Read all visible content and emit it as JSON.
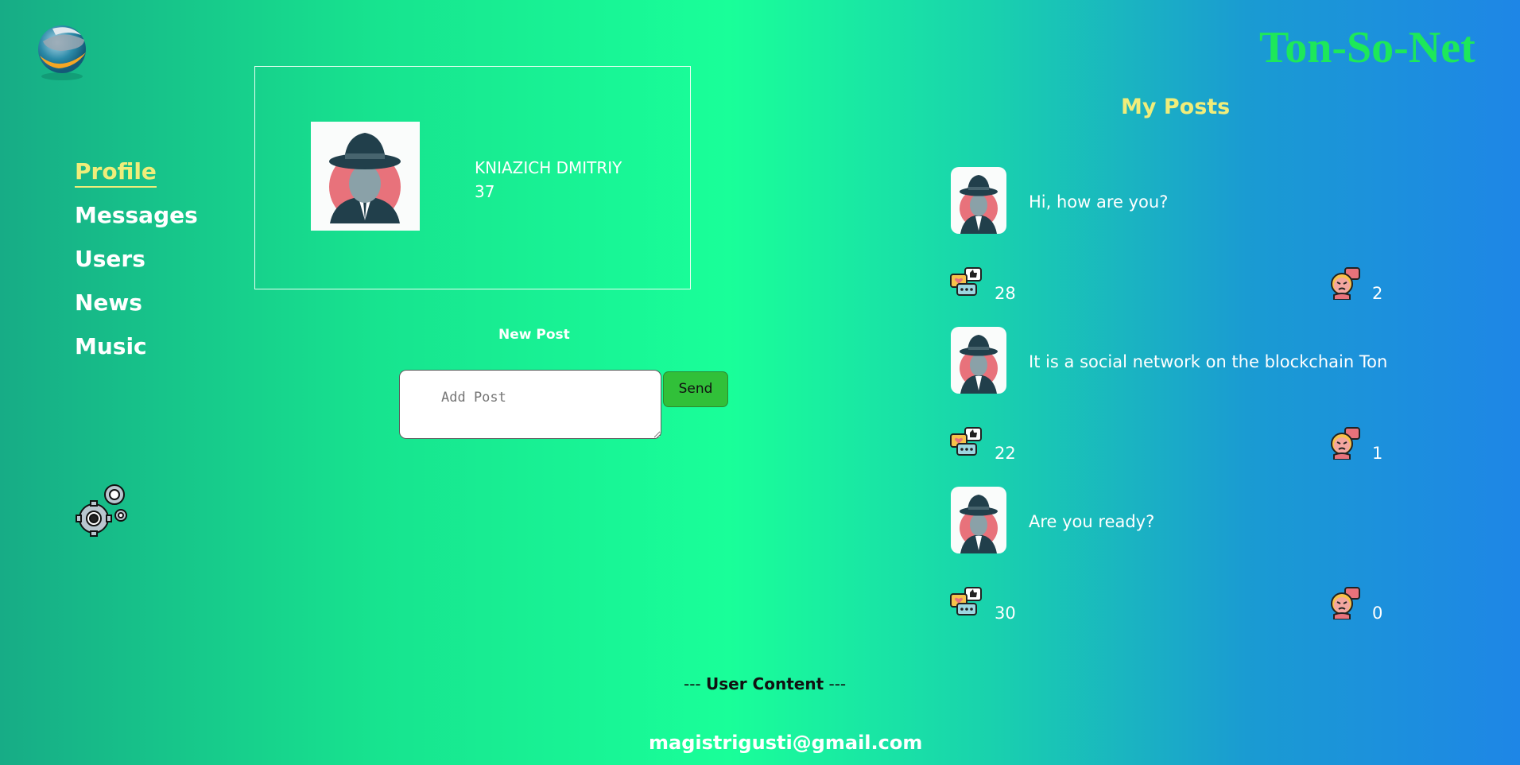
{
  "brand": "Ton-So-Net",
  "nav": {
    "items": [
      "Profile",
      "Messages",
      "Users",
      "News",
      "Music"
    ],
    "active": "Profile"
  },
  "profile": {
    "name": "KNIAZICH DMITRIY",
    "age": "37"
  },
  "new_post": {
    "title": "New Post",
    "placeholder": "Add Post",
    "send_label": "Send"
  },
  "posts": {
    "title": "My Posts",
    "items": [
      {
        "text": "Hi, how are you?",
        "likes": "28",
        "dislikes": "2"
      },
      {
        "text": "It is a social network on the blockchain Ton",
        "likes": "22",
        "dislikes": "1"
      },
      {
        "text": "Are you ready?",
        "likes": "30",
        "dislikes": "0"
      }
    ]
  },
  "footer": {
    "prefix": "--- ",
    "label": "User Content",
    "suffix": " ---",
    "email": "magistrigusti@gmail.com"
  },
  "colors": {
    "active_nav": "#f0ed7a",
    "brand": "#1de85a",
    "send_button": "#31c039"
  },
  "icons": [
    "logo-globe-icon",
    "settings-gears-icon",
    "avatar-detective-icon",
    "reactions-icon",
    "angry-face-icon"
  ]
}
